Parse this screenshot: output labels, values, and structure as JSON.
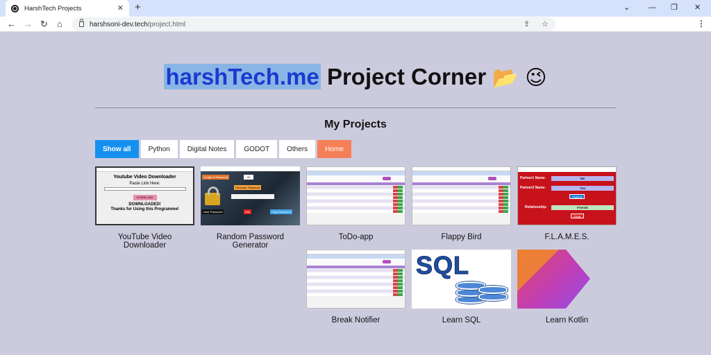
{
  "browser": {
    "tab_title": "HarshTech Projects",
    "tab_close": "✕",
    "new_tab": "+",
    "window_controls": {
      "collapse": "⌄",
      "minimize": "—",
      "restore": "❐",
      "close": "✕"
    },
    "nav": {
      "back": "←",
      "forward": "→",
      "reload": "↻",
      "home": "⌂"
    },
    "url_host": "harshsoni-dev.tech",
    "url_path": "/project.html",
    "share_icon": "⇪",
    "bookmark_icon": "☆",
    "menu_icon": "⋮"
  },
  "page": {
    "brand": "harshTech.me",
    "heading_rest": " Project Corner ",
    "heading_emoji": "📂 😉",
    "section_title": "My Projects"
  },
  "filters": [
    {
      "label": "Show all",
      "state": "active"
    },
    {
      "label": "Python",
      "state": "normal"
    },
    {
      "label": "Digital Notes",
      "state": "normal"
    },
    {
      "label": "GODOT",
      "state": "normal"
    },
    {
      "label": "Others",
      "state": "normal"
    },
    {
      "label": "Home",
      "state": "home"
    }
  ],
  "projects": [
    {
      "caption_lines": [
        "YouTube Video",
        "Downloader"
      ],
      "thumb": {
        "title": "Youtube Video Downloader",
        "prompt": "Paste Link Here:",
        "button": "DOWNLOAD",
        "status": "DOWNLOADED!",
        "thanks": "Thanks for Using this Programme!"
      }
    },
    {
      "caption_lines": [
        "Random Password",
        "Generator"
      ],
      "thumb": {
        "length_label": "Length of Password",
        "length_value": "20",
        "generate": "Generate Password",
        "clear": "clear Password",
        "exit": "Exit",
        "copy": "Copy Password"
      }
    },
    {
      "caption_lines": [
        "ToDo-app"
      ]
    },
    {
      "caption_lines": [
        "Flappy Bird"
      ]
    },
    {
      "caption_lines": [
        "F.L.A.M.E.S."
      ],
      "thumb": {
        "p1_label": "Partner1 Name:",
        "p1_value": "Me",
        "p2_label": "Partner2 Name:",
        "p2_value": "You",
        "submit": "Submit",
        "rel_label": "Relationship:",
        "rel_value": "Friends",
        "clear": "Clear"
      }
    },
    {
      "caption_lines": [
        "Break Notifier"
      ]
    },
    {
      "caption_lines": [
        "Learn SQL"
      ],
      "thumb": {
        "logo_text": "SQL"
      }
    },
    {
      "caption_lines": [
        "Learn Kotlin"
      ]
    }
  ],
  "colors": {
    "page_bg": "#cccbde",
    "brand_highlight": "#89b5e5",
    "brand_text": "#1a3ad1",
    "filter_active": "#1590ef",
    "filter_home": "#f58057"
  }
}
